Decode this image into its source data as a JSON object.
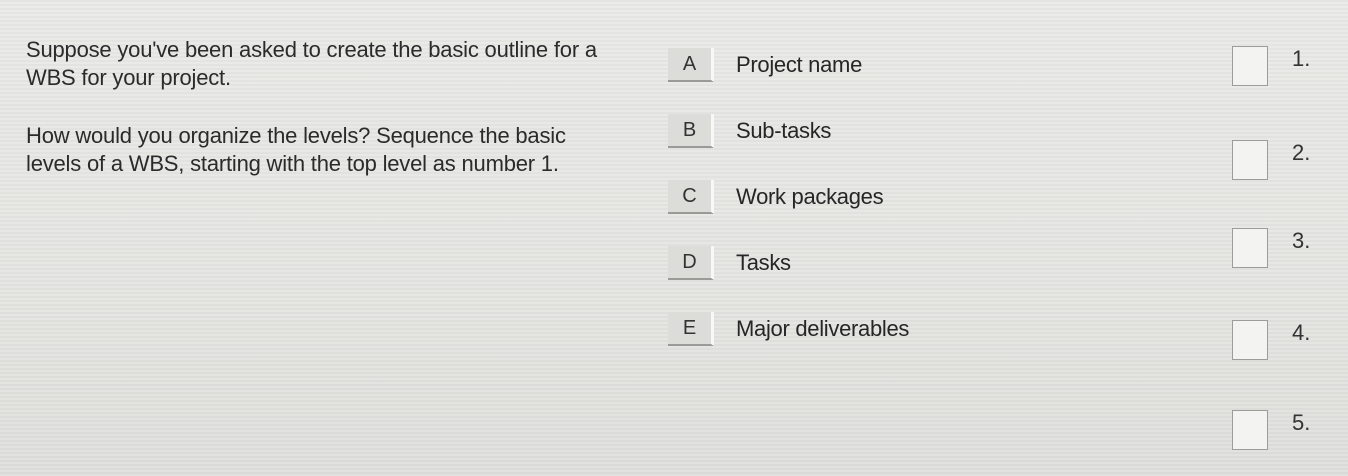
{
  "question": {
    "intro": "Suppose you've been asked to create the basic outline for a WBS for your project.",
    "instruction": "How would you organize the levels? Sequence the basic levels of a WBS, starting with the top level as number 1."
  },
  "items": [
    {
      "key": "A",
      "label": "Project name"
    },
    {
      "key": "B",
      "label": "Sub-tasks"
    },
    {
      "key": "C",
      "label": "Work packages"
    },
    {
      "key": "D",
      "label": "Tasks"
    },
    {
      "key": "E",
      "label": "Major deliverables"
    }
  ],
  "slots": [
    {
      "number": "1."
    },
    {
      "number": "2."
    },
    {
      "number": "3."
    },
    {
      "number": "4."
    },
    {
      "number": "5."
    }
  ]
}
